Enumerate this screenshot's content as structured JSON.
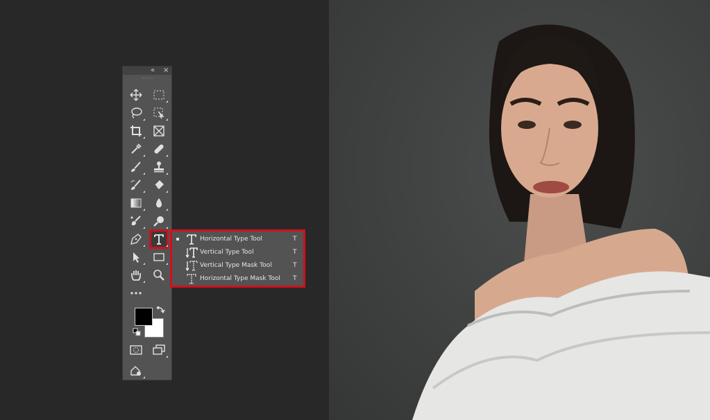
{
  "toolbar": {
    "collapse_glyph": "«",
    "close_glyph": "×",
    "tools": [
      {
        "name": "move-tool",
        "icon": "move-icon"
      },
      {
        "name": "marquee-tool",
        "icon": "rect-marquee-icon"
      },
      {
        "name": "lasso-tool",
        "icon": "lasso-icon"
      },
      {
        "name": "object-select-tool",
        "icon": "object-select-icon"
      },
      {
        "name": "crop-tool",
        "icon": "crop-icon"
      },
      {
        "name": "frame-tool",
        "icon": "frame-icon"
      },
      {
        "name": "eyedropper-tool",
        "icon": "eyedropper-icon"
      },
      {
        "name": "healing-tool",
        "icon": "bandage-icon"
      },
      {
        "name": "brush-tool",
        "icon": "brush-icon"
      },
      {
        "name": "stamp-tool",
        "icon": "stamp-icon"
      },
      {
        "name": "history-brush-tool",
        "icon": "history-brush-icon"
      },
      {
        "name": "eraser-tool",
        "icon": "eraser-icon"
      },
      {
        "name": "gradient-tool",
        "icon": "gradient-icon"
      },
      {
        "name": "blur-tool",
        "icon": "drop-icon"
      },
      {
        "name": "dodge-tool",
        "icon": "dodge-icon"
      },
      {
        "name": "sponge-tool",
        "icon": "magnifier-icon"
      },
      {
        "name": "pen-tool",
        "icon": "pen-icon"
      },
      {
        "name": "type-tool",
        "icon": "type-icon"
      },
      {
        "name": "path-select-tool",
        "icon": "arrow-icon"
      },
      {
        "name": "shape-tool",
        "icon": "rectangle-icon"
      },
      {
        "name": "hand-tool",
        "icon": "hand-icon"
      },
      {
        "name": "zoom-tool",
        "icon": "zoom-icon"
      },
      {
        "name": "more-tools",
        "icon": "ellipsis-icon"
      }
    ],
    "colors": {
      "foreground": "#000000",
      "background": "#ffffff"
    }
  },
  "type_menu": {
    "items": [
      {
        "label": "Horizontal Type Tool",
        "shortcut": "T",
        "icon": "type-horizontal-icon",
        "selected": true
      },
      {
        "label": "Vertical Type Tool",
        "shortcut": "T",
        "icon": "type-vertical-icon",
        "selected": false
      },
      {
        "label": "Vertical Type Mask Tool",
        "shortcut": "T",
        "icon": "type-vertical-mask-icon",
        "selected": false
      },
      {
        "label": "Horizontal Type Mask Tool",
        "shortcut": "T",
        "icon": "type-horizontal-mask-icon",
        "selected": false
      }
    ],
    "highlight_color": "#d0101a"
  }
}
